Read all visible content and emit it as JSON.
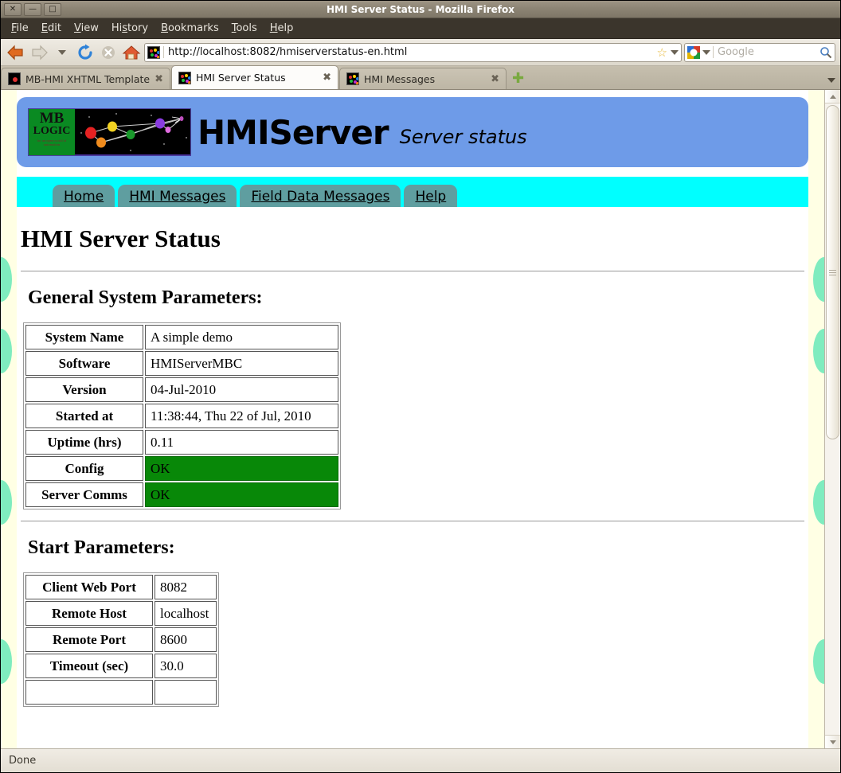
{
  "window": {
    "title": "HMI Server Status - Mozilla Firefox",
    "close_glyph": "✕",
    "minimize_glyph": "—",
    "maximize_glyph": "□"
  },
  "menubar": {
    "items": [
      {
        "name": "file",
        "pre": "F",
        "rest": "ile"
      },
      {
        "name": "edit",
        "pre": "E",
        "rest": "dit"
      },
      {
        "name": "view",
        "pre": "V",
        "rest": "iew"
      },
      {
        "name": "history",
        "pre": "Hi",
        "mid": "s",
        "rest": "tory"
      },
      {
        "name": "bookmarks",
        "pre": "B",
        "rest": "ookmarks"
      },
      {
        "name": "tools",
        "pre": "T",
        "rest": "ools"
      },
      {
        "name": "help",
        "pre": "H",
        "rest": "elp"
      }
    ],
    "file": "File",
    "edit": "Edit",
    "view": "View",
    "history": "History",
    "bookmarks": "Bookmarks",
    "tools": "Tools",
    "help": "Help"
  },
  "toolbar": {
    "back_icon": "back-arrow-icon",
    "forward_icon": "forward-arrow-icon",
    "reload_icon": "reload-icon",
    "stop_icon": "stop-icon",
    "home_icon": "home-icon",
    "url": "http://localhost:8082/hmiserverstatus-en.html",
    "bookmark_star": "☆",
    "search_placeholder": "Google",
    "search_value": ""
  },
  "browser_tabs": {
    "close_glyph": "✖",
    "new_tab_glyph": "✚",
    "items": [
      {
        "label": "MB-HMI XHTML Template",
        "active": false
      },
      {
        "label": "HMI Server Status",
        "active": true
      },
      {
        "label": "HMI Messages",
        "active": false
      }
    ]
  },
  "statusbar": {
    "text": "Done"
  },
  "page": {
    "brand": "HMIServer",
    "subtitle": "Server status",
    "logo": {
      "mb": "MB",
      "logic": "LOGIC",
      "tagline": "for an open\nworld of\nautomation"
    },
    "nav_tabs": [
      {
        "label": "Home"
      },
      {
        "label": "HMI Messages"
      },
      {
        "label": "Field Data Messages"
      },
      {
        "label": "Help"
      }
    ],
    "title": "HMI Server Status",
    "sections": [
      {
        "heading": "General System Parameters:",
        "rows": [
          {
            "label": "System Name",
            "value": "A simple demo",
            "status": false
          },
          {
            "label": "Software",
            "value": "HMIServerMBC",
            "status": false
          },
          {
            "label": "Version",
            "value": "04-Jul-2010",
            "status": false
          },
          {
            "label": "Started at",
            "value": "11:38:44, Thu 22 of Jul, 2010",
            "status": false
          },
          {
            "label": "Uptime (hrs)",
            "value": "0.11",
            "status": false
          },
          {
            "label": "Config",
            "value": "OK",
            "status": true
          },
          {
            "label": "Server Comms",
            "value": "OK",
            "status": true
          }
        ]
      },
      {
        "heading": "Start Parameters:",
        "rows": [
          {
            "label": "Client Web Port",
            "value": "8082",
            "status": false
          },
          {
            "label": "Remote Host",
            "value": "localhost",
            "status": false
          },
          {
            "label": "Remote Port",
            "value": "8600",
            "status": false
          },
          {
            "label": "Timeout (sec)",
            "value": "30.0",
            "status": false
          }
        ]
      }
    ]
  },
  "colors": {
    "banner_blue": "#6e9be8",
    "nav_cyan": "#00ffff",
    "nav_tab_teal": "#5f9ea0",
    "status_ok_green": "#088808",
    "margin_cream": "#ffffe4",
    "margin_blob_mint": "#7fecbf",
    "logo_green": "#0a8a22"
  }
}
